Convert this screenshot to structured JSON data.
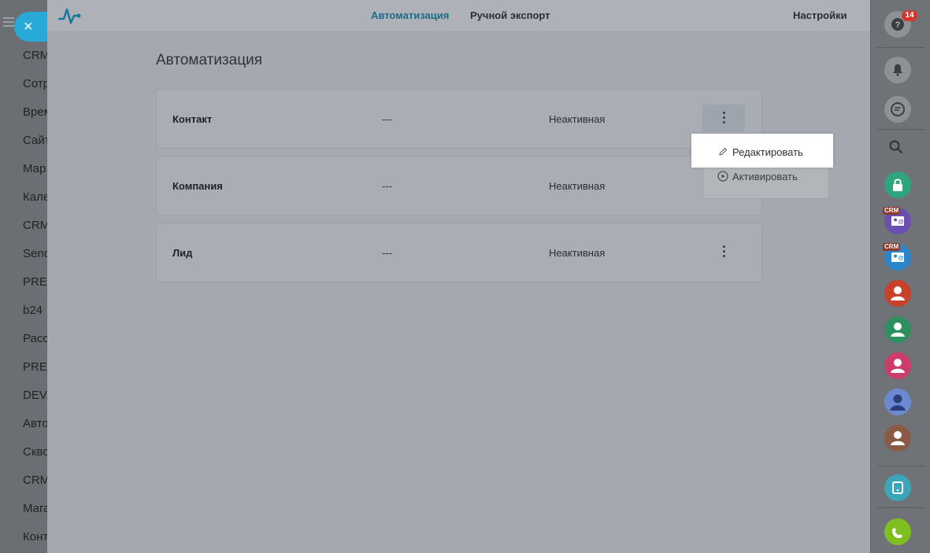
{
  "close_button": {
    "label": "×"
  },
  "left_sidebar": {
    "items": [
      "CRM",
      "Сотр",
      "Врем",
      "Сайт",
      "Мар",
      "Кале",
      "CRM",
      "Send",
      "PRE",
      "b24",
      "Расс",
      "PRE",
      "DEV",
      "Авто",
      "Скво",
      "CRM",
      "Мага",
      "Конт"
    ]
  },
  "topbar": {
    "tabs": [
      {
        "label": "Автоматизация",
        "active": true
      },
      {
        "label": "Ручной экспорт",
        "active": false
      }
    ],
    "settings_label": "Настройки"
  },
  "main": {
    "title": "Автоматизация",
    "rows": [
      {
        "name": "Контакт",
        "value": "---",
        "status": "Неактивная"
      },
      {
        "name": "Компания",
        "value": "---",
        "status": "Неактивная"
      },
      {
        "name": "Лид",
        "value": "---",
        "status": "Неактивная"
      }
    ]
  },
  "context_menu": {
    "edit_label": "Редактировать",
    "activate_label": "Активировать"
  },
  "right_sidebar": {
    "help_badge": "14",
    "crm_tag": "CRM",
    "colors": {
      "help": "#8e9196",
      "lock": "#2ea57c",
      "crm1": "#6a4fb0",
      "crm2": "#2a86c8",
      "user_red": "#c7412b",
      "user_green": "#2f8f5e",
      "user_pink": "#cc3d6c",
      "user_blue": "#6b8ad1",
      "user_brown": "#8b5a47",
      "share": "#3aa6b8",
      "phone": "#7fbf1f"
    }
  },
  "accent_color": "#1d6b87"
}
